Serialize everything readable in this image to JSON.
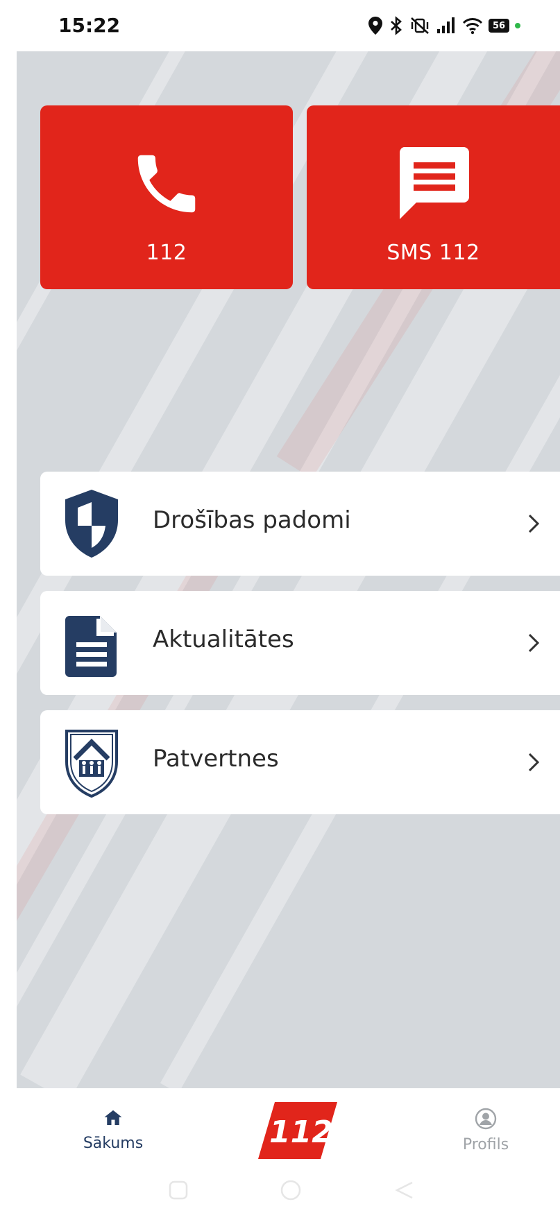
{
  "status_bar": {
    "time": "15:22",
    "battery": "56",
    "icons": [
      "location-icon",
      "bluetooth-icon",
      "vibrate-off-icon",
      "signal-icon",
      "wifi-icon",
      "battery-icon"
    ]
  },
  "emergency": {
    "call_label": "112",
    "sms_label": "SMS 112",
    "accent": "#e1251b"
  },
  "menu": {
    "items": [
      {
        "label": "Drošības padomi",
        "icon": "shield-icon"
      },
      {
        "label": "Aktualitātes",
        "icon": "document-icon"
      },
      {
        "label": "Patvertnes",
        "icon": "shelter-icon"
      }
    ]
  },
  "bottom_nav": {
    "home_label": "Sākums",
    "logo_text": "112",
    "profile_label": "Profils"
  },
  "colors": {
    "navy": "#253d63",
    "background": "#d4d8dc",
    "logo_red": "#e1251b"
  }
}
